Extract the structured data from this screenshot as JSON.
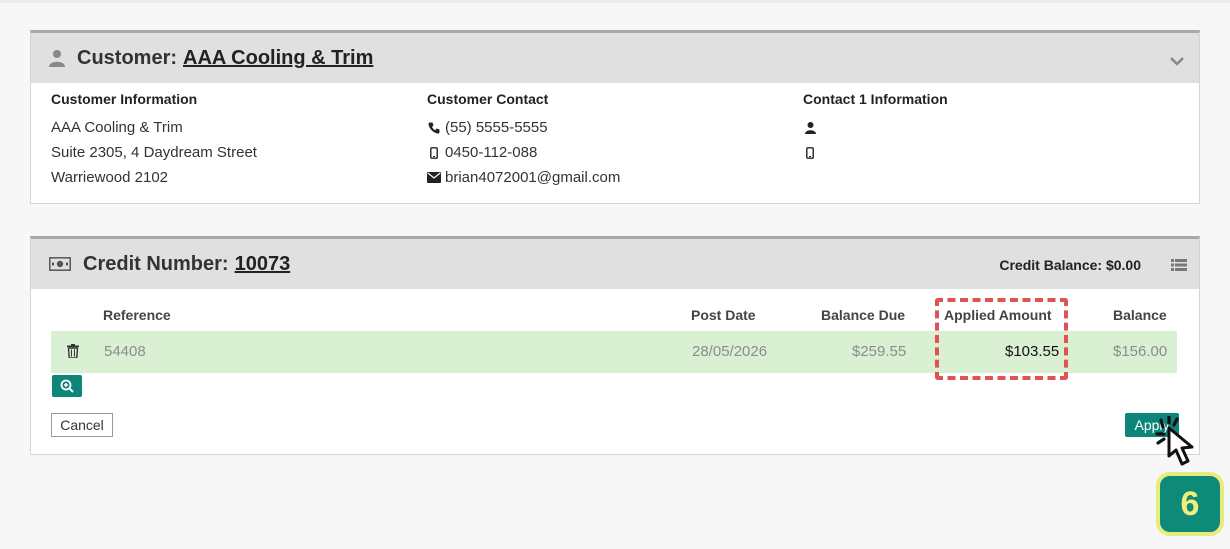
{
  "customer": {
    "title_prefix": "Customer:",
    "name": "AAA Cooling & Trim",
    "info": {
      "heading": "Customer Information",
      "lines": [
        "AAA Cooling & Trim",
        "Suite 2305, 4 Daydream Street",
        "Warriewood 2102"
      ]
    },
    "contact": {
      "heading": "Customer Contact",
      "phone": "(55) 5555-5555",
      "mobile": "0450-112-088",
      "email": "brian4072001@gmail.com"
    },
    "contact1": {
      "heading": "Contact 1 Information"
    }
  },
  "credit": {
    "title_prefix": "Credit Number:",
    "number": "10073",
    "balance": "Credit Balance: $0.00",
    "columns": {
      "reference": "Reference",
      "post_date": "Post Date",
      "balance_due": "Balance Due",
      "applied_amount": "Applied Amount",
      "balance": "Balance"
    },
    "rows": [
      {
        "reference": "54408",
        "post_date": "28/05/2026",
        "balance_due": "$259.55",
        "applied_amount": "$103.55",
        "balance": "$156.00"
      }
    ],
    "cancel_label": "Cancel",
    "apply_label": "Apply"
  },
  "step": "6",
  "colors": {
    "accent": "#0d8578",
    "row_highlight": "#d9f0d3",
    "annotation": "#e05353",
    "badge_border": "#e6ec7e"
  }
}
